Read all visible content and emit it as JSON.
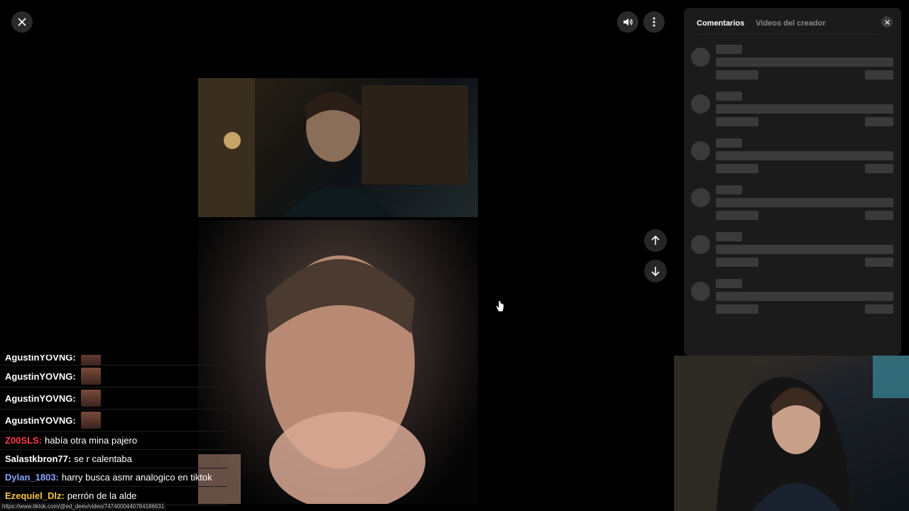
{
  "panel": {
    "tabs": [
      {
        "label": "Comentarios"
      },
      {
        "label": "Videos del creador"
      }
    ]
  },
  "chat": {
    "messages": [
      {
        "user": "AgustinYOVNG:",
        "color": "#ffffff",
        "text": "",
        "emote": true
      },
      {
        "user": "AgustinYOVNG:",
        "color": "#ffffff",
        "text": "",
        "emote": true
      },
      {
        "user": "AgustinYOVNG:",
        "color": "#ffffff",
        "text": "",
        "emote": true
      },
      {
        "user": "AgustinYOVNG:",
        "color": "#ffffff",
        "text": "",
        "emote": true
      },
      {
        "user": "Z00SLS:",
        "color": "#ff3b4e",
        "text": "había otra mina pajero",
        "emote": false
      },
      {
        "user": "Salastkbron77:",
        "color": "#ffffff",
        "text": "se r calentaba",
        "emote": false
      },
      {
        "user": "Dylan_1803:",
        "color": "#8aa4ff",
        "text": "harry busca asmr analogico en tiktok",
        "emote": false
      },
      {
        "user": "Ezequiel_Dlz:",
        "color": "#f5c542",
        "text": "perrón de la alde",
        "emote": false
      }
    ]
  },
  "status_url": "https://www.tiktok.com/@ed_deev/video/7474000440784186631",
  "icons": {
    "close": "close-icon",
    "volume": "volume-icon",
    "more": "more-vertical-icon",
    "up": "arrow-up-icon",
    "down": "arrow-down-icon"
  }
}
